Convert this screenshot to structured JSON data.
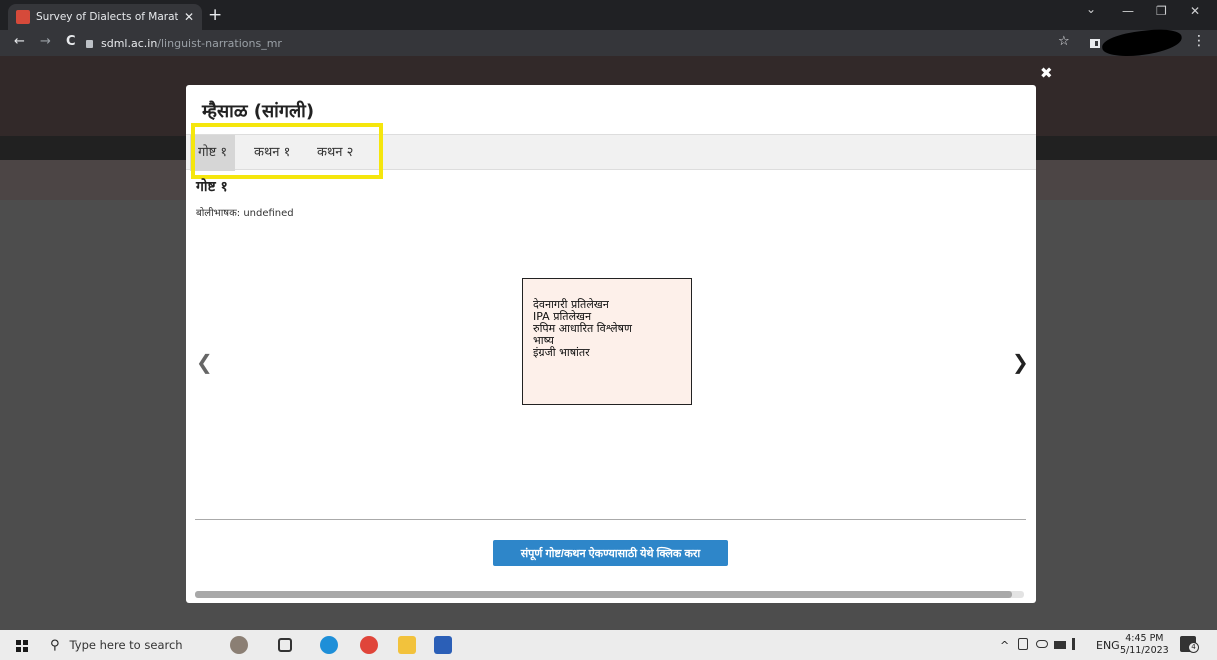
{
  "browser": {
    "tab_title": "Survey of Dialects of Marathi Lan",
    "tab_close": "✕",
    "new_tab": "+",
    "url_host": "sdml.ac.in",
    "url_path": "/linguist-narrations_mr",
    "back": "←",
    "forward": "→",
    "reload": "C",
    "star": "☆",
    "menu": "⋮",
    "chevron": "⌄",
    "minimize": "—",
    "restore": "❐",
    "close": "✕"
  },
  "modal": {
    "close": "✖",
    "title": "म्हैसाळ (सांगली)",
    "tabs": [
      {
        "label": "गोष्ट १",
        "active": true
      },
      {
        "label": "कथन १",
        "active": false
      },
      {
        "label": "कथन २",
        "active": false
      }
    ],
    "story_heading": "गोष्ट १",
    "speaker_label": "बोलीभाषक:",
    "speaker_value": "undefined",
    "prev_arrow": "❮",
    "next_arrow": "❯",
    "options": [
      "देवनागरी प्रतिलेखन",
      "IPA प्रतिलेखन",
      "रुपिम आधारित विश्लेषण",
      "भाष्य",
      "इंग्रजी भाषांतर"
    ],
    "play_button": "संपूर्ण गोष्ट/कथन ऐकण्यासाठी येथे क्लिक करा",
    "highlight_color": "#f5e60d",
    "button_color": "#2e86c9"
  },
  "taskbar": {
    "search_placeholder": "Type here to search",
    "search_icon": "⚲",
    "tray_chevron": "^",
    "lang": "ENG",
    "time": "4:45 PM",
    "date": "5/11/2023",
    "notification_count": "4"
  }
}
